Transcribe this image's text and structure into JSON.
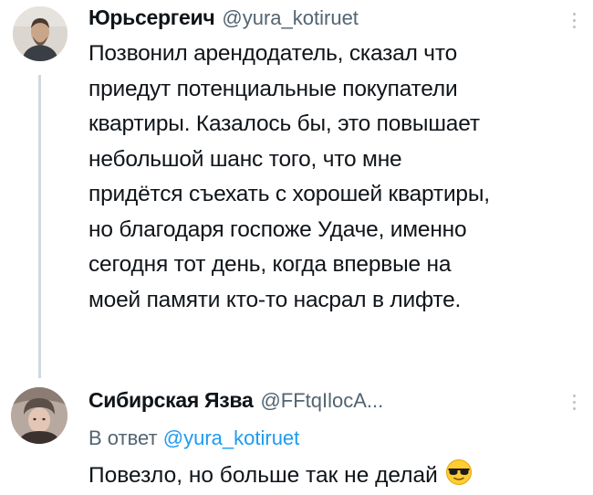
{
  "tweet1": {
    "name": "Юрьсергеич",
    "handle": "@yura_kotiruet",
    "lines": [
      "Позвонил арендодатель, сказал что",
      "приедут потенциальные покупатели",
      "квартиры. Казалось бы, это повышает",
      "небольшой шанс того, что мне",
      "придётся съехать с хорошей квартиры,",
      "но благодаря госпоже Удаче, именно",
      "сегодня тот день, когда впервые на",
      "моей памяти кто-то насрал в лифте."
    ]
  },
  "tweet2": {
    "name": "Сибирская Язва",
    "handle": "@FFtqIlocA...",
    "reply_prefix": "В ответ",
    "reply_mention": "@yura_kotiruet",
    "text": "Повезло, но больше так не делай",
    "emoji_icon": "sunglasses-face-icon"
  }
}
